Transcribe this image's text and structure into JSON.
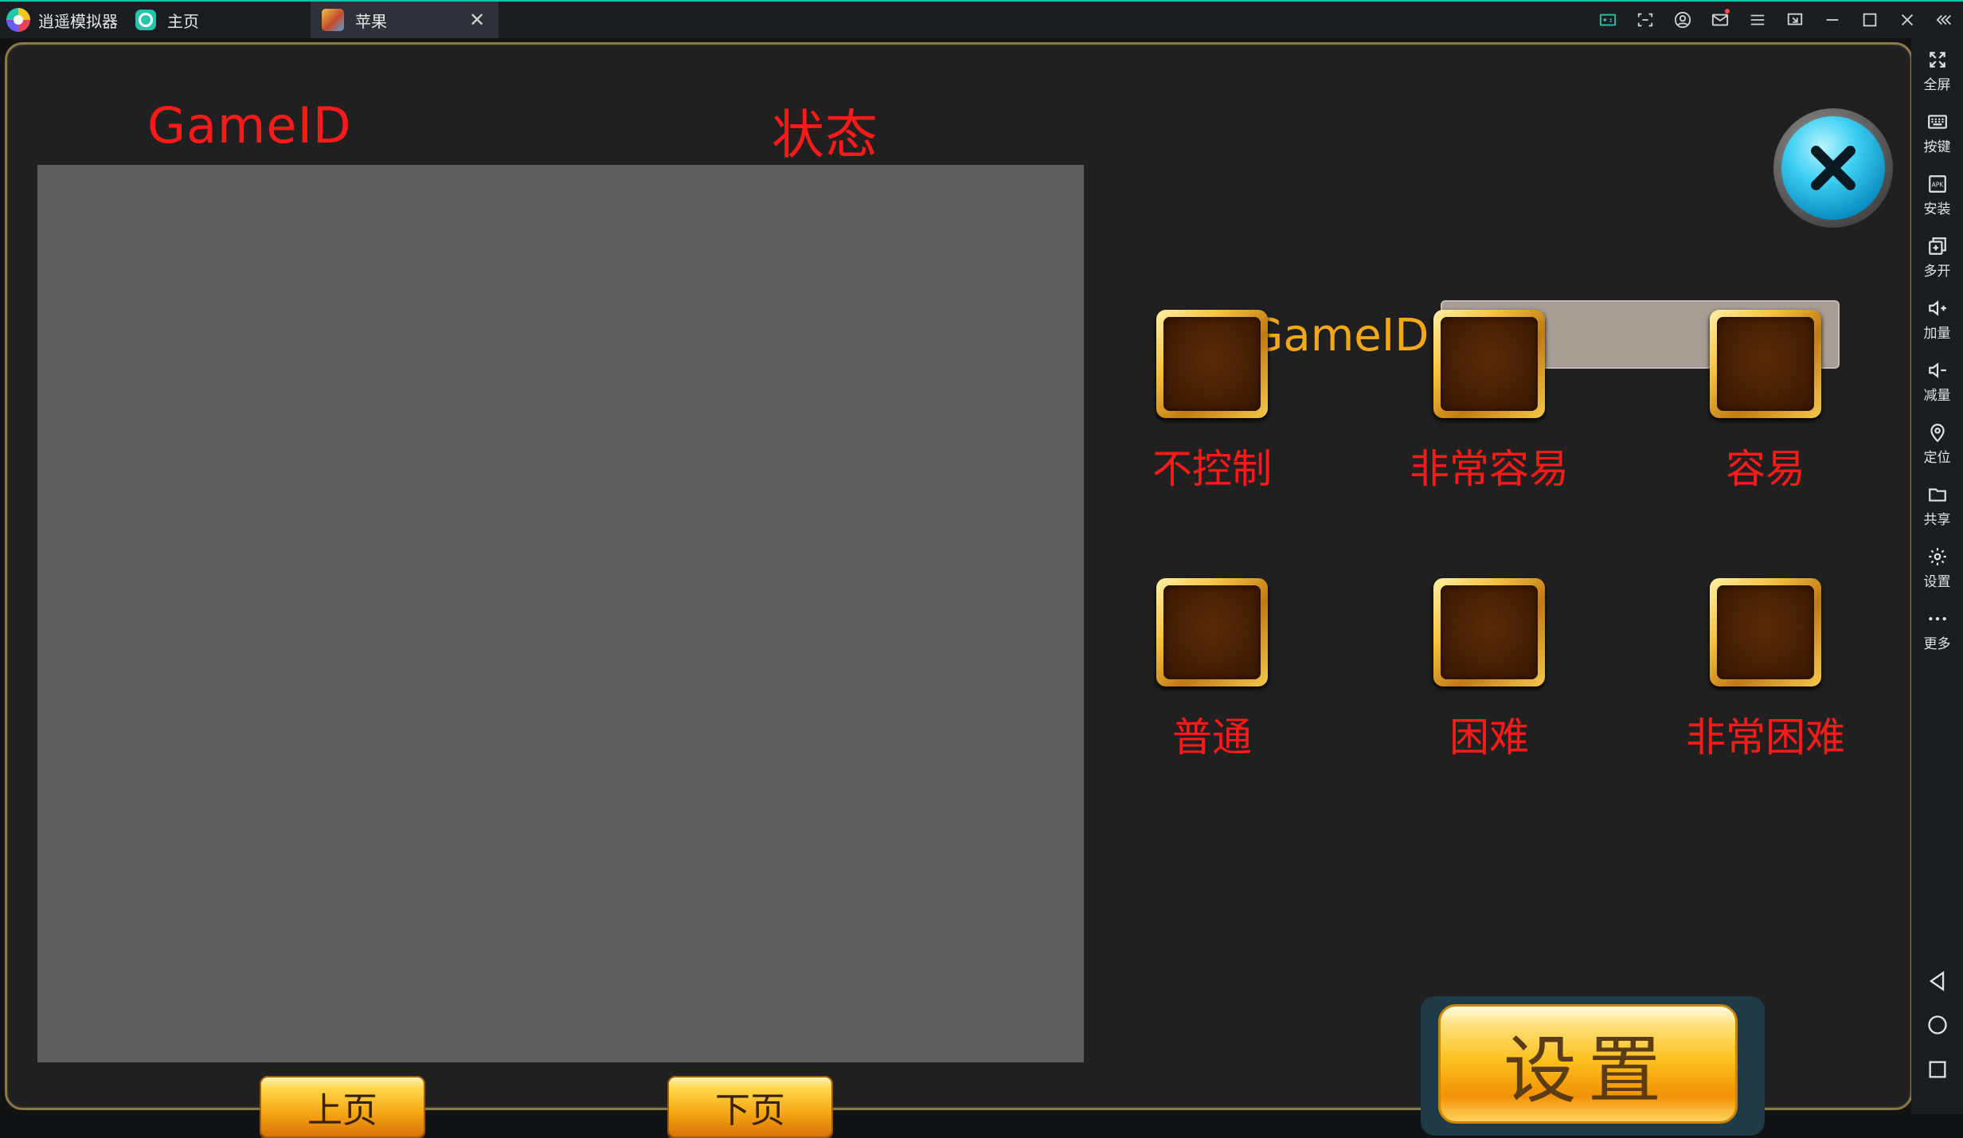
{
  "titlebar": {
    "brand": "逍遥模拟器",
    "tabs": [
      {
        "label": "主页",
        "icon": "home-app-icon"
      },
      {
        "label": "苹果",
        "icon": "game-app-icon",
        "active": true
      }
    ],
    "accent_color": "#15c5ad"
  },
  "sidebar": {
    "items": [
      {
        "label": "全屏",
        "icon": "fullscreen-icon"
      },
      {
        "label": "按键",
        "icon": "keyboard-icon"
      },
      {
        "label": "安装",
        "icon": "apk-install-icon"
      },
      {
        "label": "多开",
        "icon": "multi-instance-icon"
      },
      {
        "label": "加量",
        "icon": "volume-up-icon"
      },
      {
        "label": "减量",
        "icon": "volume-down-icon"
      },
      {
        "label": "定位",
        "icon": "location-pin-icon"
      },
      {
        "label": "共享",
        "icon": "folder-icon"
      },
      {
        "label": "设置",
        "icon": "gear-icon"
      },
      {
        "label": "更多",
        "icon": "more-dots-icon"
      }
    ],
    "nav": [
      "back-triangle-icon",
      "home-circle-icon",
      "recents-square-icon"
    ]
  },
  "game": {
    "header_gameid": "GameID",
    "header_status": "状态",
    "prev_page": "上页",
    "next_page": "下页",
    "control_label": "控制GameID:",
    "control_input_value": "",
    "options": [
      {
        "label": "不控制"
      },
      {
        "label": "非常容易"
      },
      {
        "label": "容易"
      },
      {
        "label": "普通"
      },
      {
        "label": "困难"
      },
      {
        "label": "非常困难"
      }
    ],
    "set_button": "设置",
    "header_color": "#ff1a1a",
    "label_color": "#f2a81a"
  }
}
